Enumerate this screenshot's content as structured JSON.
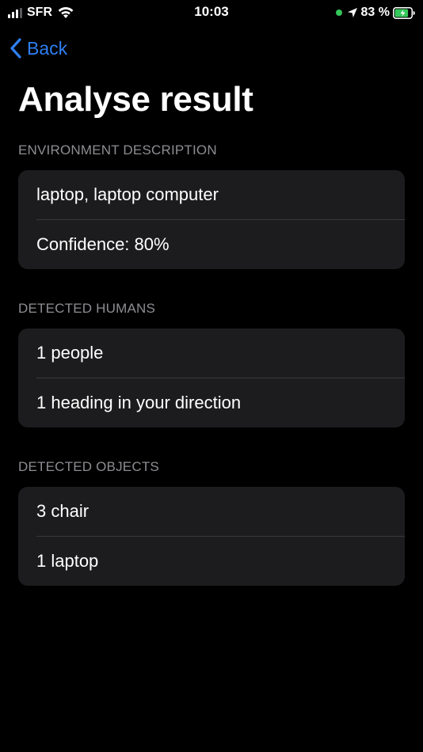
{
  "colors": {
    "background": "#000000",
    "card": "#1c1c1e",
    "divider": "#38383a",
    "text": "#ffffff",
    "secondary_text": "#8d8d93",
    "accent": "#2f7ff5",
    "camera_indicator": "#34c759",
    "battery_charging": "#34c759"
  },
  "status_bar": {
    "carrier": "SFR",
    "time": "10:03",
    "battery_percent": "83 %",
    "battery_level": 0.83,
    "icons": [
      "signal-icon",
      "wifi-icon",
      "camera-in-use-indicator",
      "location-arrow-icon",
      "battery-charging-icon"
    ]
  },
  "nav": {
    "back_label": "Back",
    "back_icon": "chevron-left-icon"
  },
  "page": {
    "title": "Analyse result"
  },
  "sections": [
    {
      "header": "ENVIRONMENT DESCRIPTION",
      "rows": [
        "laptop,  laptop computer",
        "Confidence: 80%"
      ]
    },
    {
      "header": "DETECTED HUMANS",
      "rows": [
        "1 people",
        "1 heading in your direction"
      ]
    },
    {
      "header": "DETECTED OBJECTS",
      "rows": [
        "3 chair",
        "1 laptop"
      ]
    }
  ]
}
